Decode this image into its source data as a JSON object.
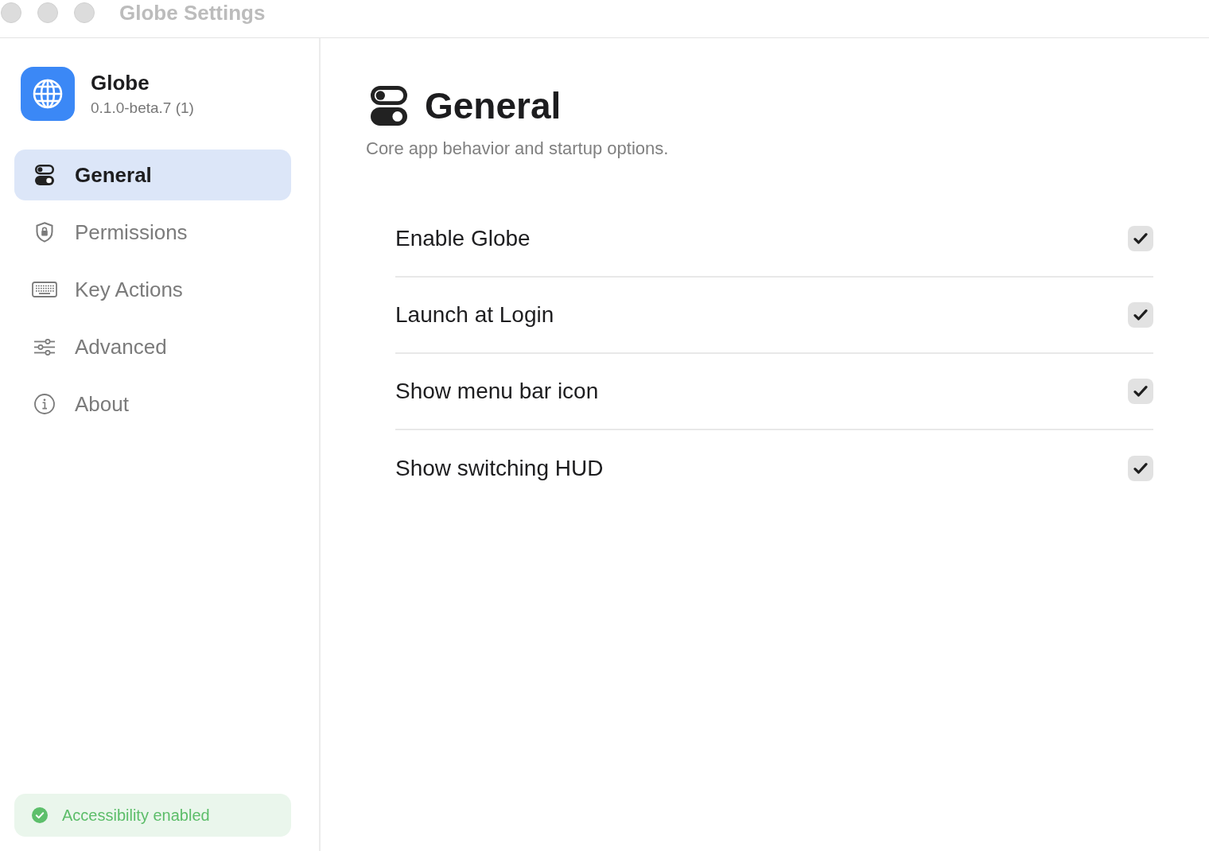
{
  "window": {
    "title": "Globe Settings"
  },
  "sidebar": {
    "app": {
      "name": "Globe",
      "version": "0.1.0-beta.7 (1)"
    },
    "items": [
      {
        "label": "General",
        "selected": true
      },
      {
        "label": "Permissions",
        "selected": false
      },
      {
        "label": "Key Actions",
        "selected": false
      },
      {
        "label": "Advanced",
        "selected": false
      },
      {
        "label": "About",
        "selected": false
      }
    ],
    "status": {
      "text": "Accessibility enabled",
      "ok": true
    }
  },
  "page": {
    "title": "General",
    "subtitle": "Core app behavior and startup options."
  },
  "settings": [
    {
      "label": "Enable Globe",
      "checked": true
    },
    {
      "label": "Launch at Login",
      "checked": true
    },
    {
      "label": "Show menu bar icon",
      "checked": true
    },
    {
      "label": "Show switching HUD",
      "checked": true
    }
  ]
}
